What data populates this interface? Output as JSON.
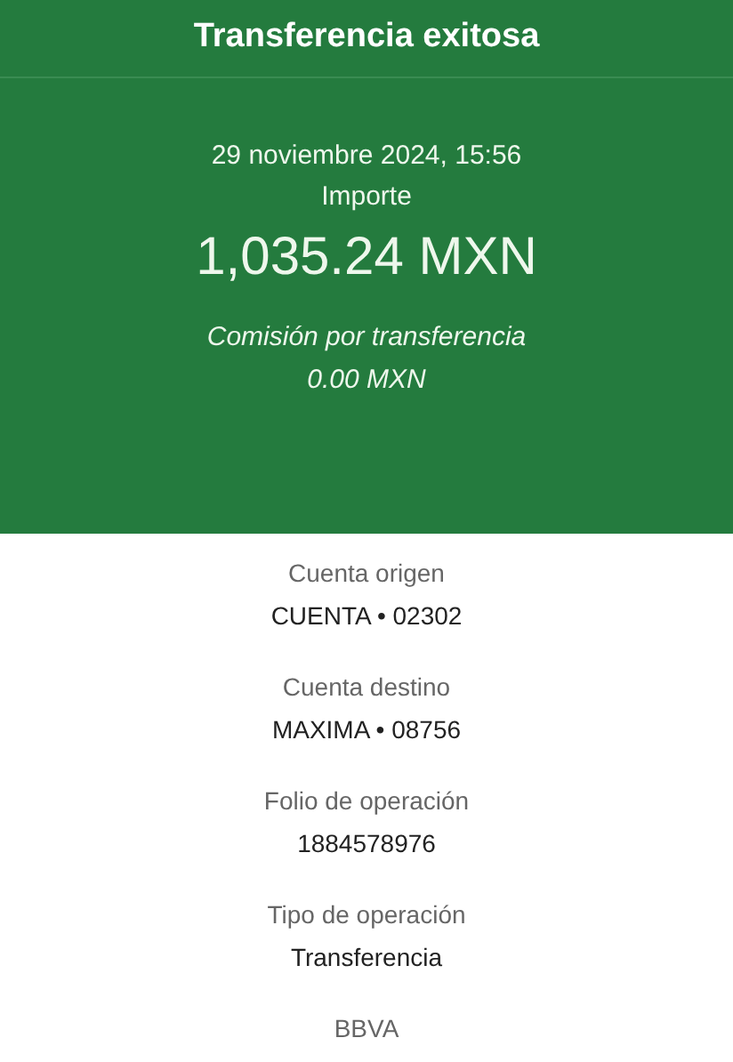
{
  "header": {
    "title": "Transferencia exitosa"
  },
  "summary": {
    "date": "29 noviembre 2024, 15:56",
    "amount_label": "Importe",
    "amount": "1,035.24 MXN",
    "fee_label": "Comisión por transferencia",
    "fee": "0.00 MXN"
  },
  "details": [
    {
      "label": "Cuenta origen",
      "value": "CUENTA • 02302"
    },
    {
      "label": "Cuenta destino",
      "value": "MAXIMA • 08756"
    },
    {
      "label": "Folio de operación",
      "value": "1884578976"
    },
    {
      "label": "Tipo de operación",
      "value": "Transferencia"
    }
  ],
  "footer": {
    "bank": "BBVA"
  }
}
